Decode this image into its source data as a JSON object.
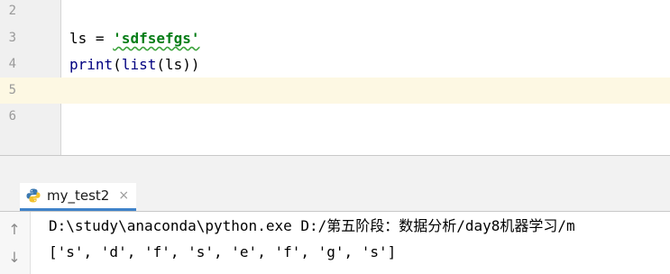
{
  "editor": {
    "lines": [
      {
        "number": "2",
        "code": ""
      },
      {
        "number": "3",
        "code_var": "ls",
        "code_op": " = ",
        "code_str": "'sdfsefgs'"
      },
      {
        "number": "4",
        "code_fn1": "print",
        "code_p1": "(",
        "code_fn2": "list",
        "code_rest": "(ls))"
      },
      {
        "number": "5",
        "code": ""
      },
      {
        "number": "6",
        "code": ""
      }
    ]
  },
  "run": {
    "label": "",
    "tab_title": "my_test2",
    "close_glyph": "×",
    "output": [
      "D:\\study\\anaconda\\python.exe D:/第五阶段：数据分析/day8机器学习/m",
      "['s', 'd', 'f', 's', 'e', 'f', 'g', 's']"
    ]
  },
  "icons": {
    "up": "↑",
    "down": "↓"
  },
  "colors": {
    "string": "#067d17",
    "current_line": "#fdf8e3",
    "tab_underline": "#4083c9"
  }
}
